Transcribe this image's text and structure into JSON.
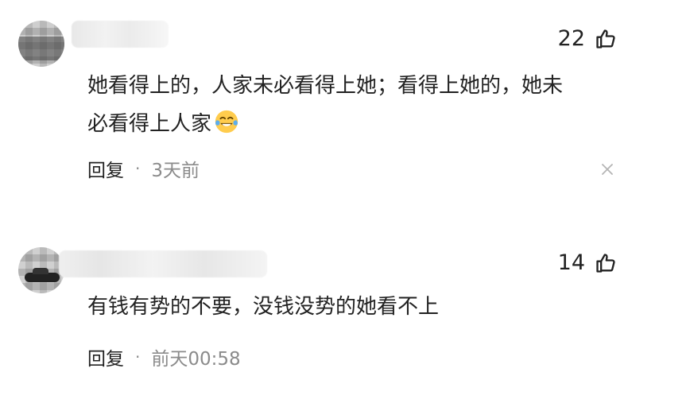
{
  "comments": [
    {
      "likes": "22",
      "text_line1": "她看得上的，人家未必看得上她；看得上她的，她未",
      "text_line2": "必看得上人家",
      "reply": "回复",
      "separator": "·",
      "time": "3天前",
      "emoji_icon": "laughing-tears-emoji-icon",
      "like_icon": "thumb-up-icon",
      "close_icon": "close-icon"
    },
    {
      "likes": "14",
      "text": "有钱有势的不要，没钱没势的她看不上",
      "reply": "回复",
      "separator": "·",
      "time": "前天00:58",
      "like_icon": "thumb-up-icon"
    }
  ],
  "colors": {
    "primary_text": "#222222",
    "secondary_text": "#8b8b8b",
    "background": "#ffffff"
  }
}
